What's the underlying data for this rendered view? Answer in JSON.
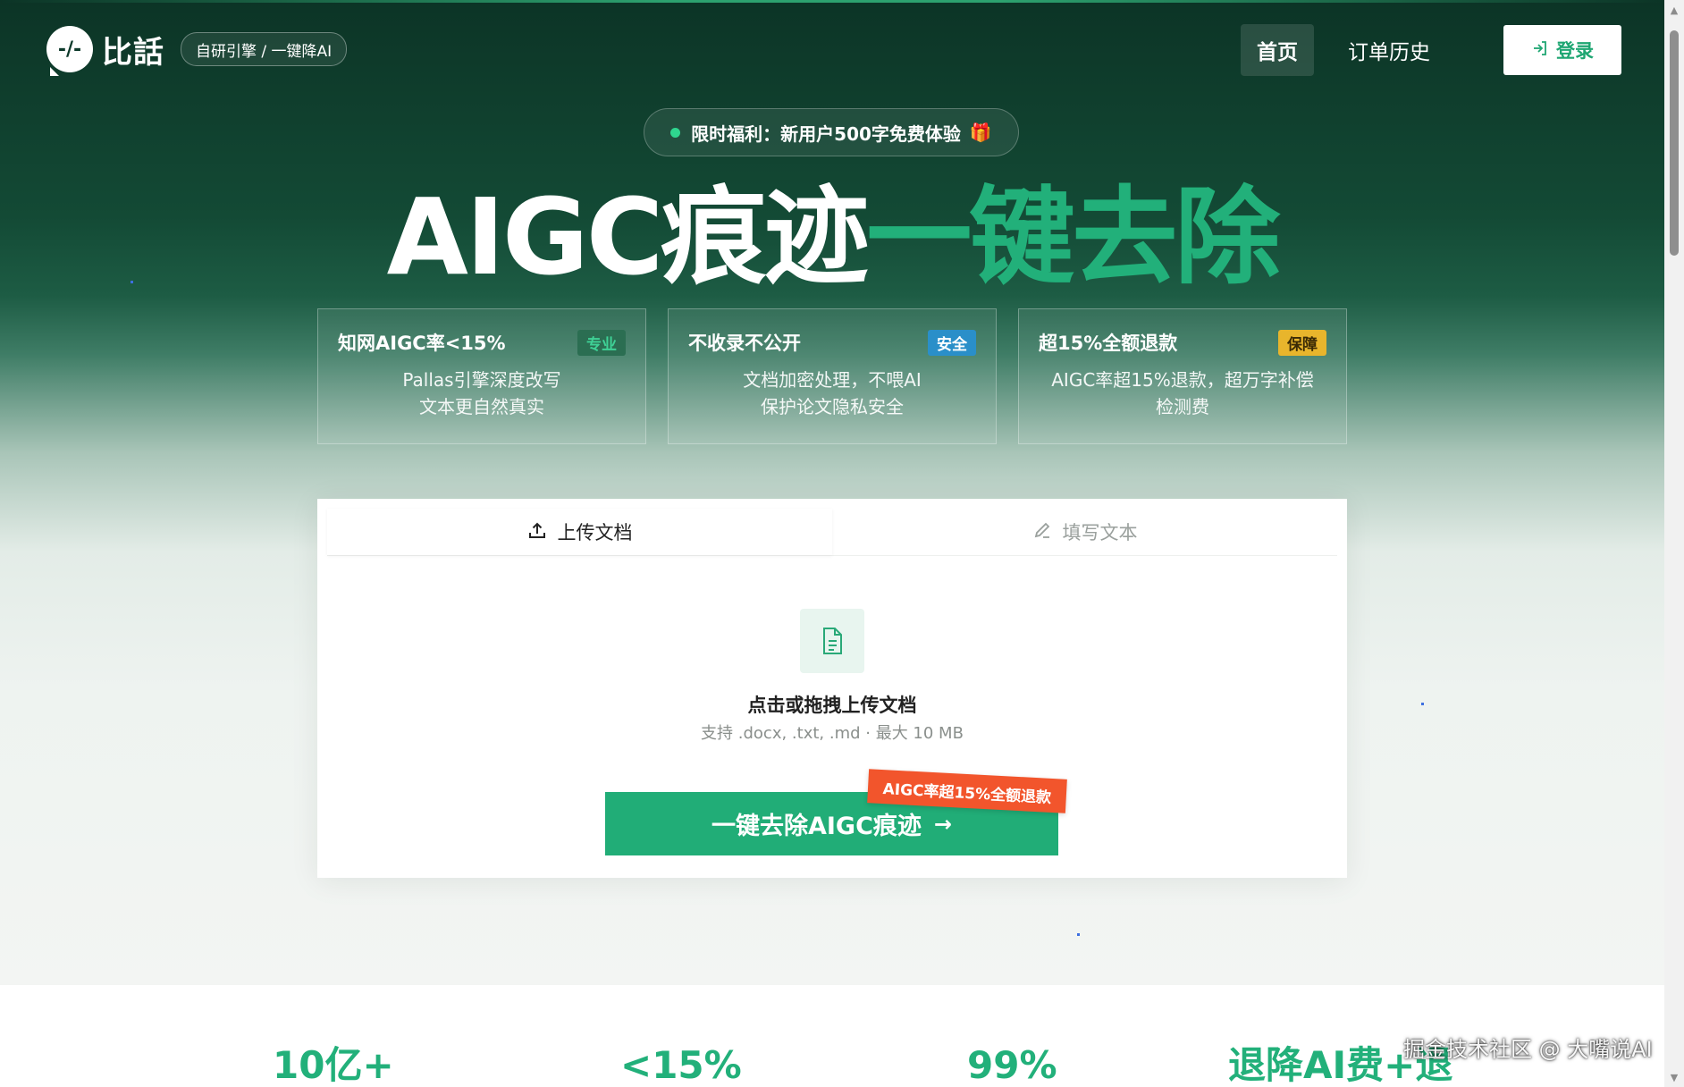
{
  "nav": {
    "logo_mark": "-/-",
    "logo_text": "比話",
    "tagline": "自研引擎 / 一键降AI",
    "links": [
      {
        "label": "首页",
        "active": true
      },
      {
        "label": "订单历史",
        "active": false
      }
    ],
    "login_label": "登录",
    "login_icon": "login-arrow-icon"
  },
  "promo": {
    "text": "限时福利：新用户500字免费体验",
    "icon": "gift-icon",
    "gift_glyph": "🎁"
  },
  "headline": {
    "white_part": "AIGC痕迹",
    "green_part": "一键去除"
  },
  "features": [
    {
      "title": "知网AIGC率<15%",
      "badge": "专业",
      "badge_color": "#2aa978",
      "badge_bg": "#2f7a5c",
      "line1": "Pallas引擎深度改写",
      "line2": "文本更自然真实"
    },
    {
      "title": "不收录不公开",
      "badge": "安全",
      "badge_color": "#ffffff",
      "badge_bg": "#2a8fc9",
      "line1": "文档加密处理，不喂AI",
      "line2": "保护论文隐私安全"
    },
    {
      "title": "超15%全额退款",
      "badge": "保障",
      "badge_color": "#3a2a05",
      "badge_bg": "#e8b52c",
      "line1": "AIGC率超15%退款，超万字补偿",
      "line2": "检测费"
    }
  ],
  "upload": {
    "tab_upload": "上传文档",
    "tab_text": "填写文本",
    "title": "点击或拖拽上传文档",
    "hint": "支持 .docx, .txt, .md · 最大 10 MB",
    "cta": "一键去除AIGC痕迹",
    "ribbon": "AIGC率超15%全额退款"
  },
  "stats": [
    "10亿+",
    "<15%",
    "99%",
    "退降AI费+退"
  ],
  "watermark": "掘金技术社区 @ 大嘴说AI",
  "colors": {
    "brand_green": "#22b07a",
    "hero_dark": "#0c3426",
    "ribbon_red": "#f2552c"
  }
}
